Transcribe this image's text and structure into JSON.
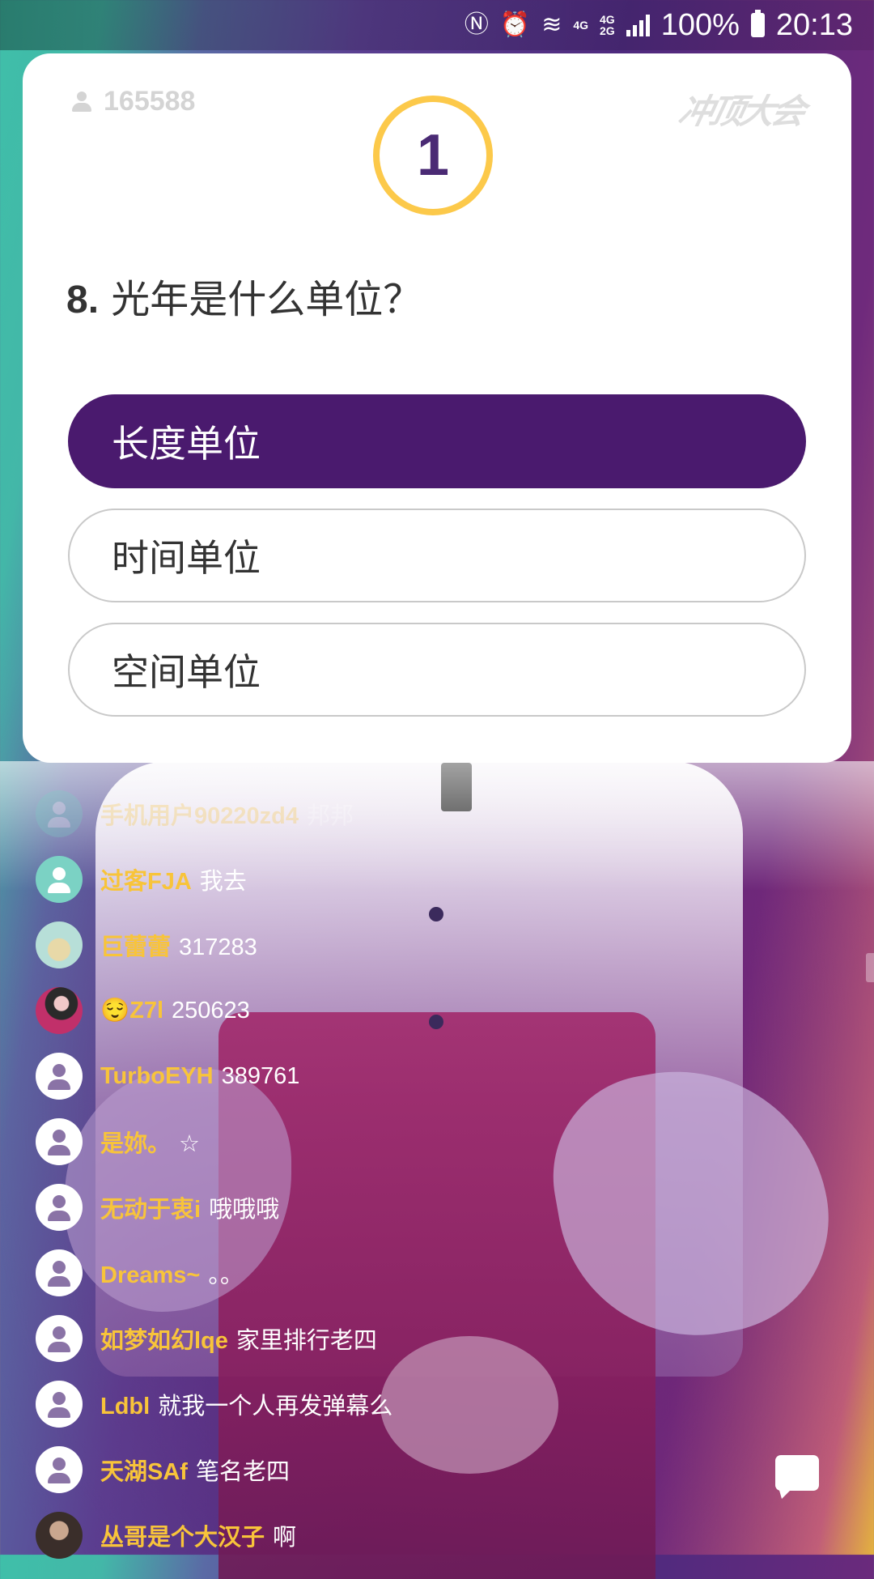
{
  "status_bar": {
    "net_a": "4G",
    "net_b_top": "4G",
    "net_b_bottom": "2G",
    "battery": "100%",
    "time": "20:13"
  },
  "quiz": {
    "player_count": "165588",
    "logo_text": "冲顶大会",
    "countdown": "1",
    "question_number": "8.",
    "question_text": "光年是什么单位？",
    "options": [
      {
        "label": "长度单位",
        "selected": true
      },
      {
        "label": "时间单位",
        "selected": false
      },
      {
        "label": "空间单位",
        "selected": false
      }
    ],
    "accent_color": "#4a1a6e",
    "timer_color": "#fcc94a"
  },
  "chat": {
    "messages": [
      {
        "user": "手机用户90220zd4",
        "text": "邦邦",
        "avatar": "teal"
      },
      {
        "user": "过客FJA",
        "text": "我去",
        "avatar": "teal"
      },
      {
        "user": "巨蕾蕾",
        "text": "317283",
        "avatar": "cat"
      },
      {
        "user": "😌Z7l",
        "text": "250623",
        "avatar": "photo"
      },
      {
        "user": "TurboEYH",
        "text": "389761",
        "avatar": "default"
      },
      {
        "user": "是妳。",
        "text": "☆",
        "avatar": "default"
      },
      {
        "user": "无动于衷i",
        "text": "哦哦哦",
        "avatar": "default"
      },
      {
        "user": "Dreams~",
        "text": "。。",
        "avatar": "default"
      },
      {
        "user": "如梦如幻lqe",
        "text": "家里排行老四",
        "avatar": "default"
      },
      {
        "user": "Ldbl",
        "text": "就我一个人再发弹幕么",
        "avatar": "default"
      },
      {
        "user": "天湖SAf",
        "text": "笔名老四",
        "avatar": "default"
      },
      {
        "user": "丛哥是个大汉子",
        "text": "啊",
        "avatar": "photo2"
      }
    ],
    "username_color": "#f8c43a"
  }
}
